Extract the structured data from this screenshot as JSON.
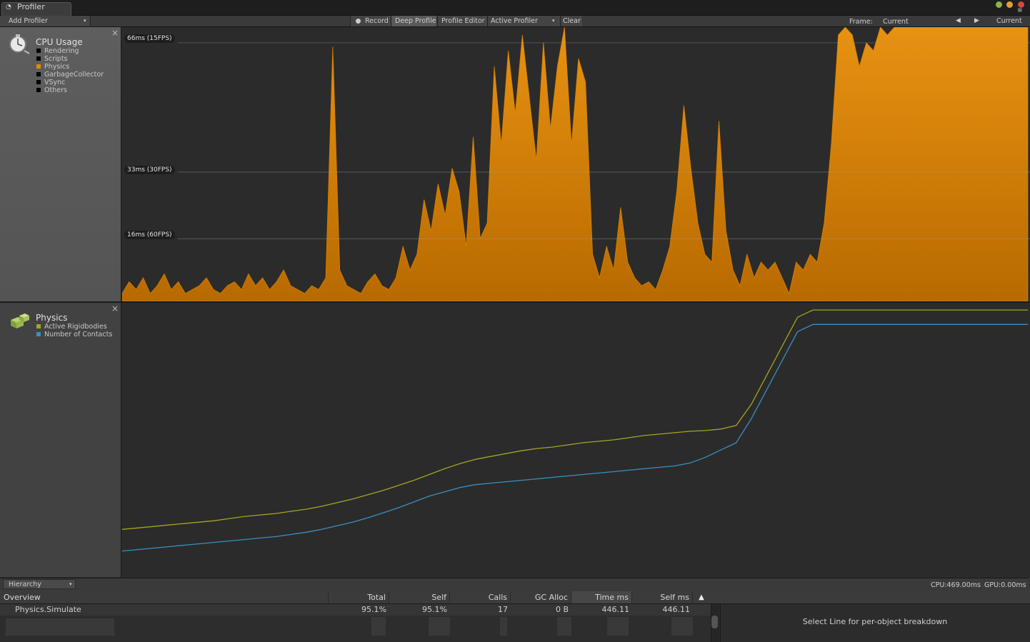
{
  "window": {
    "tab_title": "Profiler"
  },
  "toolbar": {
    "add_profiler": "Add Profiler",
    "record": "Record",
    "deep_profile": "Deep Profile",
    "profile_editor": "Profile Editor",
    "active_profiler": "Active Profiler",
    "clear": "Clear",
    "frame_label": "Frame:",
    "frame_value": "Current",
    "current_button": "Current"
  },
  "cpu_module": {
    "title": "CPU Usage",
    "legend": [
      {
        "label": "Rendering",
        "color": "#000000"
      },
      {
        "label": "Scripts",
        "color": "#000000"
      },
      {
        "label": "Physics",
        "color": "#e08a00"
      },
      {
        "label": "GarbageCollector",
        "color": "#000000"
      },
      {
        "label": "VSync",
        "color": "#000000"
      },
      {
        "label": "Others",
        "color": "#000000"
      }
    ],
    "thresholds": [
      "66ms (15FPS)",
      "33ms (30FPS)",
      "16ms (60FPS)"
    ]
  },
  "physics_module": {
    "title": "Physics",
    "legend": [
      {
        "label": "Active Rigidbodies",
        "color": "#a2a620"
      },
      {
        "label": "Number of Contacts",
        "color": "#3a8fc0"
      }
    ]
  },
  "chart_data": [
    {
      "type": "area",
      "series": [
        {
          "name": "Physics",
          "color": "#d98200",
          "values_ms": [
            2,
            5,
            3,
            6,
            2,
            4,
            7,
            3,
            5,
            2,
            3,
            4,
            6,
            3,
            2,
            4,
            5,
            3,
            7,
            4,
            6,
            3,
            5,
            8,
            4,
            3,
            2,
            4,
            3,
            6,
            65,
            8,
            4,
            3,
            2,
            5,
            7,
            4,
            3,
            6,
            14,
            8,
            12,
            26,
            18,
            30,
            22,
            34,
            28,
            14,
            42,
            16,
            20,
            60,
            40,
            64,
            48,
            68,
            52,
            36,
            66,
            44,
            60,
            70,
            40,
            62,
            56,
            12,
            6,
            14,
            8,
            24,
            10,
            6,
            4,
            5,
            3,
            8,
            14,
            28,
            50,
            34,
            20,
            12,
            10,
            46,
            18,
            8,
            4,
            12,
            6,
            10,
            8,
            10,
            6,
            2,
            10,
            8,
            12,
            10,
            20,
            40,
            68,
            70,
            68,
            60,
            66,
            64,
            70,
            68,
            70,
            70,
            70,
            70,
            70,
            70,
            70,
            70,
            70,
            70,
            70,
            70,
            70,
            70,
            70,
            70,
            70,
            70,
            70,
            70
          ]
        }
      ],
      "ylim": [
        0,
        70
      ]
    },
    {
      "type": "line",
      "series": [
        {
          "name": "Active Rigidbodies",
          "color": "#a2a620",
          "values": [
            66,
            68,
            70,
            72,
            74,
            76,
            78,
            81,
            84,
            86,
            88,
            91,
            94,
            98,
            103,
            108,
            114,
            120,
            127,
            134,
            142,
            150,
            157,
            163,
            167,
            171,
            175,
            178,
            180,
            183,
            186,
            188,
            190,
            193,
            196,
            198,
            200,
            202,
            203,
            205,
            210,
            240,
            280,
            320,
            360,
            370,
            370,
            370,
            370,
            370,
            370,
            370,
            370,
            370,
            370,
            370,
            370,
            370,
            370,
            370
          ]
        },
        {
          "name": "Number of Contacts",
          "color": "#3a8fc0",
          "values": [
            36,
            38,
            40,
            42,
            44,
            46,
            48,
            50,
            52,
            54,
            56,
            59,
            62,
            66,
            71,
            76,
            82,
            89,
            96,
            104,
            112,
            118,
            124,
            128,
            130,
            132,
            134,
            136,
            138,
            140,
            142,
            144,
            146,
            148,
            150,
            152,
            154,
            158,
            166,
            176,
            186,
            220,
            260,
            300,
            340,
            350,
            350,
            350,
            350,
            350,
            350,
            350,
            350,
            350,
            350,
            350,
            350,
            350,
            350,
            350
          ]
        }
      ],
      "ylim": [
        0,
        380
      ]
    }
  ],
  "bottom_bar": {
    "view_mode": "Hierarchy",
    "cpu_time": "CPU:469.00ms",
    "gpu_time": "GPU:0.00ms"
  },
  "hierarchy": {
    "columns": [
      "Overview",
      "Total",
      "Self",
      "Calls",
      "GC Alloc",
      "Time ms",
      "Self ms"
    ],
    "rows": [
      {
        "name": "Physics.Simulate",
        "total": "95.1%",
        "self": "95.1%",
        "calls": "17",
        "gc_alloc": "0 B",
        "time_ms": "446.11",
        "self_ms": "446.11"
      }
    ],
    "detail_message": "Select Line for per-object breakdown"
  }
}
